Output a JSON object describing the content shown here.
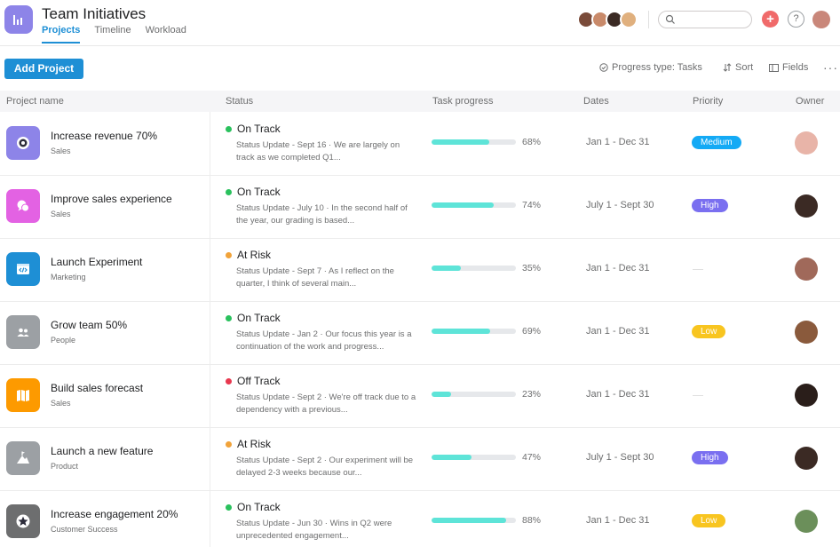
{
  "header": {
    "title": "Team Initiatives",
    "tabs": [
      {
        "label": "Projects",
        "active": true
      },
      {
        "label": "Timeline",
        "active": false
      },
      {
        "label": "Workload",
        "active": false
      }
    ],
    "member_avatars": [
      "#7a4b3a",
      "#c98a6a",
      "#3b2a24",
      "#e0b07e"
    ],
    "search_placeholder": "",
    "plus_icon": "+",
    "help_icon": "?"
  },
  "toolbar": {
    "add_project_label": "Add Project",
    "progress_type_label": "Progress type: Tasks",
    "sort_label": "Sort",
    "fields_label": "Fields",
    "more_label": "···"
  },
  "table": {
    "columns": [
      "Project name",
      "Status",
      "Task progress",
      "Dates",
      "Priority",
      "Owner"
    ],
    "rows": [
      {
        "name": "Increase revenue 70%",
        "team": "Sales",
        "icon": "target-icon",
        "icon_color": "#8d84e8",
        "status": "On Track",
        "status_color": "#2ac15d",
        "update": "Status Update - Sept 16 · We are largely on track as we completed Q1...",
        "progress": 0.68,
        "progress_label": "68%",
        "dates": "Jan 1 - Dec 31",
        "priority": "Medium",
        "priority_color": "#14aaf5",
        "owner_color": "#e8b4a8"
      },
      {
        "name": "Improve sales experience",
        "team": "Sales",
        "icon": "chat-bubbles-icon",
        "icon_color": "#e362e3",
        "status": "On Track",
        "status_color": "#2ac15d",
        "update": "Status Update - July 10 · In the second half of the year, our grading is based...",
        "progress": 0.74,
        "progress_label": "74%",
        "dates": "July 1 - Sept 30",
        "priority": "High",
        "priority_color": "#7a6ff0",
        "owner_color": "#3b2a24"
      },
      {
        "name": "Launch Experiment",
        "team": "Marketing",
        "icon": "code-window-icon",
        "icon_color": "#1e8fd5",
        "status": "At Risk",
        "status_color": "#f1a33a",
        "update": "Status Update - Sept 7 · As I reflect on the quarter, I think of several main...",
        "progress": 0.35,
        "progress_label": "35%",
        "dates": "Jan 1 - Dec 31",
        "priority": "",
        "priority_color": "",
        "owner_color": "#a0695a"
      },
      {
        "name": "Grow team 50%",
        "team": "People",
        "icon": "people-icon",
        "icon_color": "#9ca0a4",
        "status": "On Track",
        "status_color": "#2ac15d",
        "update": "Status Update - Jan 2 · Our focus this year is a continuation of the work and progress...",
        "progress": 0.69,
        "progress_label": "69%",
        "dates": "Jan 1 - Dec 31",
        "priority": "Low",
        "priority_color": "#f8c520",
        "owner_color": "#8a5a3c"
      },
      {
        "name": "Build sales forecast",
        "team": "Sales",
        "icon": "map-icon",
        "icon_color": "#fd9a00",
        "status": "Off Track",
        "status_color": "#e8384f",
        "update": "Status Update - Sept 2 · We're off track due to a dependency with a previous...",
        "progress": 0.23,
        "progress_label": "23%",
        "dates": "Jan 1 - Dec 31",
        "priority": "",
        "priority_color": "",
        "owner_color": "#2a1e1a"
      },
      {
        "name": "Launch a new feature",
        "team": "Product",
        "icon": "mountain-flag-icon",
        "icon_color": "#9ca0a4",
        "status": "At Risk",
        "status_color": "#f1a33a",
        "update": "Status Update - Sept 2 · Our experiment will be delayed 2-3 weeks because our...",
        "progress": 0.47,
        "progress_label": "47%",
        "dates": "July 1 - Sept 30",
        "priority": "High",
        "priority_color": "#7a6ff0",
        "owner_color": "#3b2a24"
      },
      {
        "name": "Increase engagement 20%",
        "team": "Customer Success",
        "icon": "star-icon",
        "icon_color": "#6d6e6f",
        "status": "On Track",
        "status_color": "#2ac15d",
        "update": "Status Update - Jun 30 · Wins in Q2 were unprecedented engagement...",
        "progress": 0.88,
        "progress_label": "88%",
        "dates": "Jan 1 - Dec 31",
        "priority": "Low",
        "priority_color": "#f8c520",
        "owner_color": "#6b8f5a"
      }
    ]
  }
}
